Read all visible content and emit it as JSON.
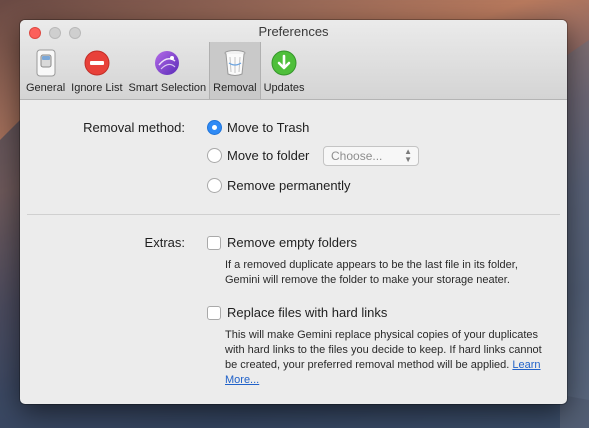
{
  "window": {
    "title": "Preferences"
  },
  "toolbar": {
    "items": [
      {
        "label": "General",
        "icon": "toggle-switch-icon"
      },
      {
        "label": "Ignore List",
        "icon": "no-entry-icon"
      },
      {
        "label": "Smart Selection",
        "icon": "smart-selection-icon"
      },
      {
        "label": "Removal",
        "icon": "trash-icon",
        "active": true
      },
      {
        "label": "Updates",
        "icon": "download-arrow-icon"
      }
    ]
  },
  "removal": {
    "label": "Removal method:",
    "options": {
      "trash": "Move to Trash",
      "folder": "Move to folder",
      "permanent": "Remove permanently"
    },
    "selected": "Move to Trash",
    "folder_popup": "Choose..."
  },
  "extras": {
    "label": "Extras:",
    "empty_folders": {
      "label": "Remove empty folders",
      "checked": false,
      "description": "If a removed duplicate appears to be the last file in its folder, Gemini will remove the folder to make your storage neater."
    },
    "hard_links": {
      "label": "Replace files with hard links",
      "checked": false,
      "description": "This will make Gemini replace physical copies of your duplicates with hard links to the files you decide to keep. If hard links cannot be created, your preferred removal method will be applied.",
      "learn_more": "Learn More..."
    }
  },
  "colors": {
    "accent": "#2f8af5",
    "link": "#2162c9",
    "close": "#fc605b"
  }
}
